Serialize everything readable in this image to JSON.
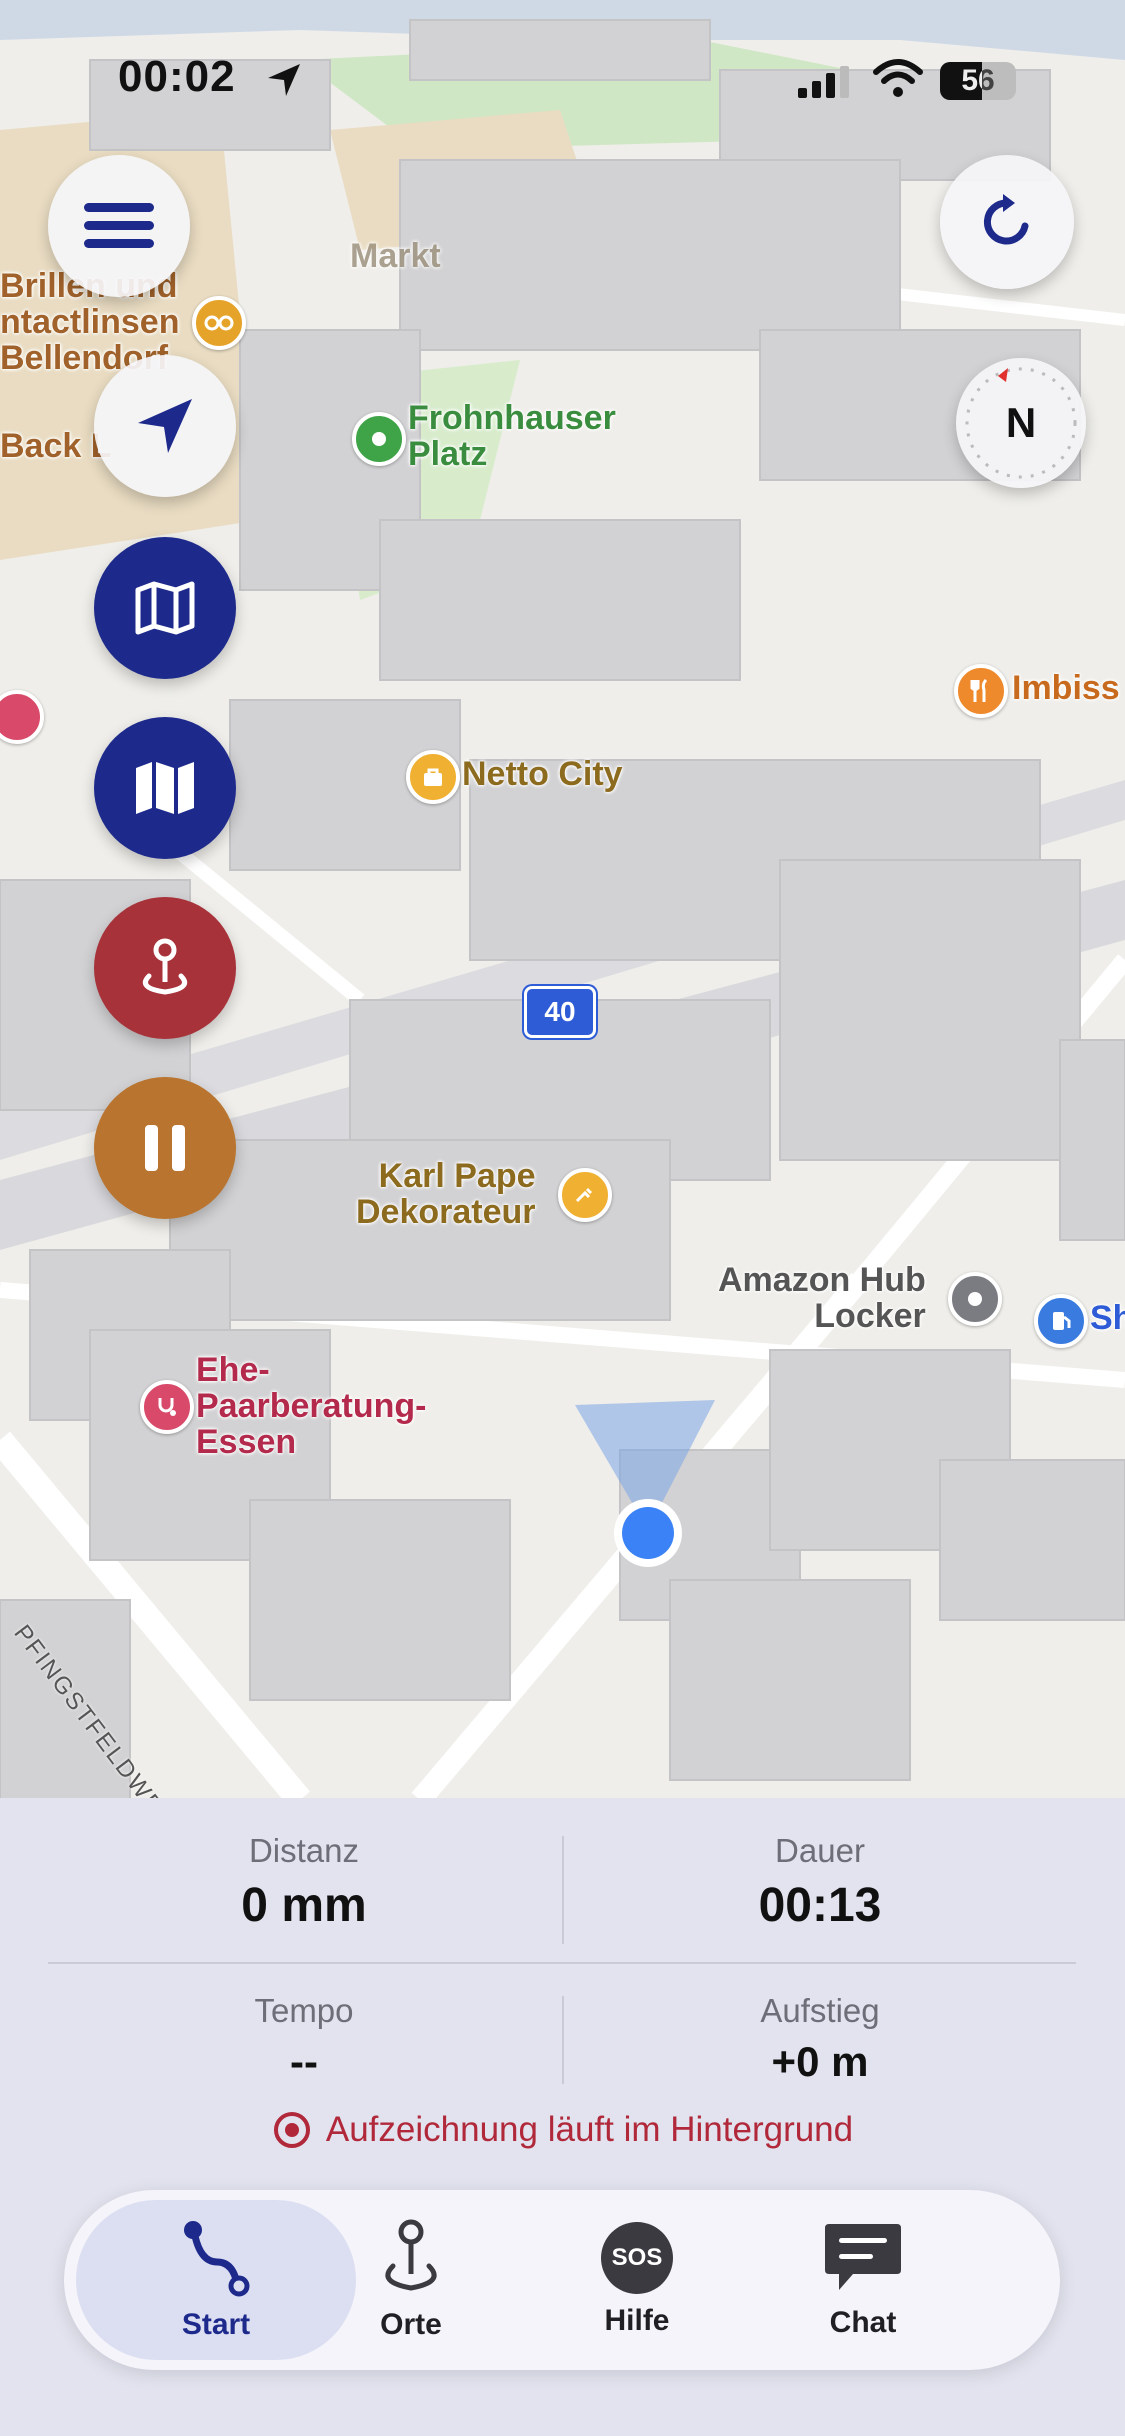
{
  "status_bar": {
    "time": "00:02",
    "battery": "56"
  },
  "map": {
    "labels": {
      "markt": "Markt",
      "brillen": [
        "Brillen und",
        "ntactlinsen",
        "Bellendorf"
      ],
      "back": "Back L",
      "frohnhauser": [
        "Frohnhauser",
        "Platz"
      ],
      "imbiss": "Imbiss",
      "netto": "Netto City",
      "road_shield": "40",
      "karl": [
        "Karl Pape",
        "Dekorateur"
      ],
      "amazon": [
        "Amazon Hub",
        "Locker"
      ],
      "sh": "Sh",
      "ehe": [
        "Ehe-",
        "Paarberatung-",
        "Essen"
      ],
      "street": "PFINGSTFELDWENDE"
    },
    "compass_label": "N",
    "colors": {
      "nav_blue": "#1d2a8c",
      "pin_red": "#a8323a",
      "pause_brown": "#b9742f",
      "user_location": "#3b82f6"
    }
  },
  "stats": {
    "distance_label": "Distanz",
    "distance_value": "0 mm",
    "duration_label": "Dauer",
    "duration_value": "00:13",
    "pace_label": "Tempo",
    "pace_value": "--",
    "ascent_label": "Aufstieg",
    "ascent_value": "+0 m"
  },
  "background_info": "Aufzeichnung läuft im Hintergrund",
  "tabs": [
    {
      "label": "Start",
      "icon": "route-icon",
      "active": true
    },
    {
      "label": "Orte",
      "icon": "pin-icon",
      "active": false
    },
    {
      "label": "Hilfe",
      "icon": "sos-icon",
      "active": false
    },
    {
      "label": "Chat",
      "icon": "chat-icon",
      "active": false
    }
  ]
}
